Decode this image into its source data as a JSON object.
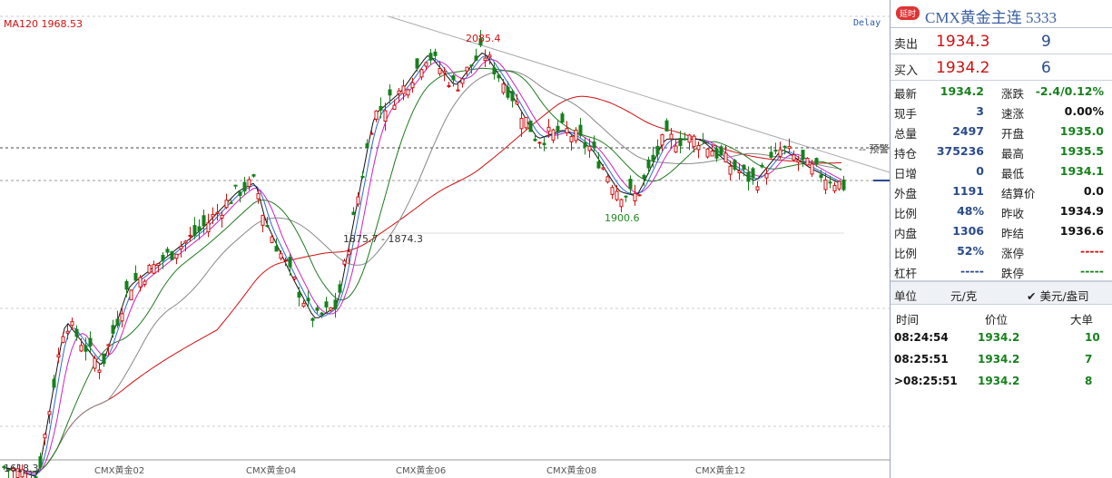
{
  "chart": {
    "ma_label": "MA120 1968.53",
    "delay_label": "Delay",
    "annotations": {
      "high": "2085.4",
      "low_mid": "1900.6",
      "range": "1875.7 - 1874.3",
      "low_left": "1618.3",
      "alert": "-- 预警 --"
    },
    "x_ticks": [
      "CMX黄金02",
      "CMX黄金04",
      "CMX黄金06",
      "CMX黄金08",
      "CMX黄金12"
    ]
  },
  "chart_data": {
    "type": "candlestick",
    "title": "",
    "moving_average": {
      "name": "MA120",
      "value": 1968.53
    },
    "price_levels": {
      "high": 2085.4,
      "low": 1618.3,
      "mid_low": 1900.6,
      "range_low": [
        1875.7,
        1874.3
      ]
    },
    "x_labels": [
      "CMX黄金02",
      "CMX黄金04",
      "CMX黄金06",
      "CMX黄金08",
      "CMX黄金12"
    ]
  },
  "panel": {
    "badge": "延时",
    "title": "CMX黄金主连  5333",
    "ask": {
      "label": "卖出",
      "price": "1934.3",
      "volume": "9"
    },
    "bid": {
      "label": "买入",
      "price": "1934.2",
      "volume": "6"
    },
    "stats": [
      {
        "l1": "最新",
        "v1": "1934.2",
        "c1": "green",
        "l2": "涨跌",
        "v2": "-2.4/0.12%",
        "c2": "green"
      },
      {
        "l1": "现手",
        "v1": "3",
        "c1": "blue",
        "l2": "速涨",
        "v2": "0.00%",
        "c2": "black"
      },
      {
        "l1": "总量",
        "v1": "2497",
        "c1": "blue",
        "l2": "开盘",
        "v2": "1935.0",
        "c2": "green"
      },
      {
        "l1": "持仓",
        "v1": "375236",
        "c1": "blue",
        "l2": "最高",
        "v2": "1935.5",
        "c2": "green"
      },
      {
        "l1": "日增",
        "v1": "0",
        "c1": "blue",
        "l2": "最低",
        "v2": "1934.1",
        "c2": "green"
      },
      {
        "l1": "外盘",
        "v1": "1191",
        "c1": "blue",
        "l2": "结算价",
        "v2": "0.0",
        "c2": "black"
      },
      {
        "l1": "比例",
        "v1": "48%",
        "c1": "blue",
        "l2": "昨收",
        "v2": "1934.9",
        "c2": "black"
      },
      {
        "l1": "内盘",
        "v1": "1306",
        "c1": "blue",
        "l2": "昨结",
        "v2": "1936.6",
        "c2": "black"
      },
      {
        "l1": "比例",
        "v1": "52%",
        "c1": "blue",
        "l2": "涨停",
        "v2": "-----",
        "c2": "red"
      },
      {
        "l1": "杠杆",
        "v1": "-----",
        "c1": "blue",
        "l2": "跌停",
        "v2": "-----",
        "c2": "green"
      }
    ],
    "unit": {
      "label": "单位",
      "value": "元/克",
      "alt": "✔ 美元/盎司"
    },
    "ticks_header": {
      "time": "时间",
      "price": "价位",
      "size": "大单"
    },
    "ticks": [
      {
        "time": "08:24:54",
        "price": "1934.2",
        "size": "10"
      },
      {
        "time": "08:25:51",
        "price": "1934.2",
        "size": "7"
      },
      {
        "time": ">08:25:51",
        "price": "1934.2",
        "size": "8"
      }
    ]
  }
}
